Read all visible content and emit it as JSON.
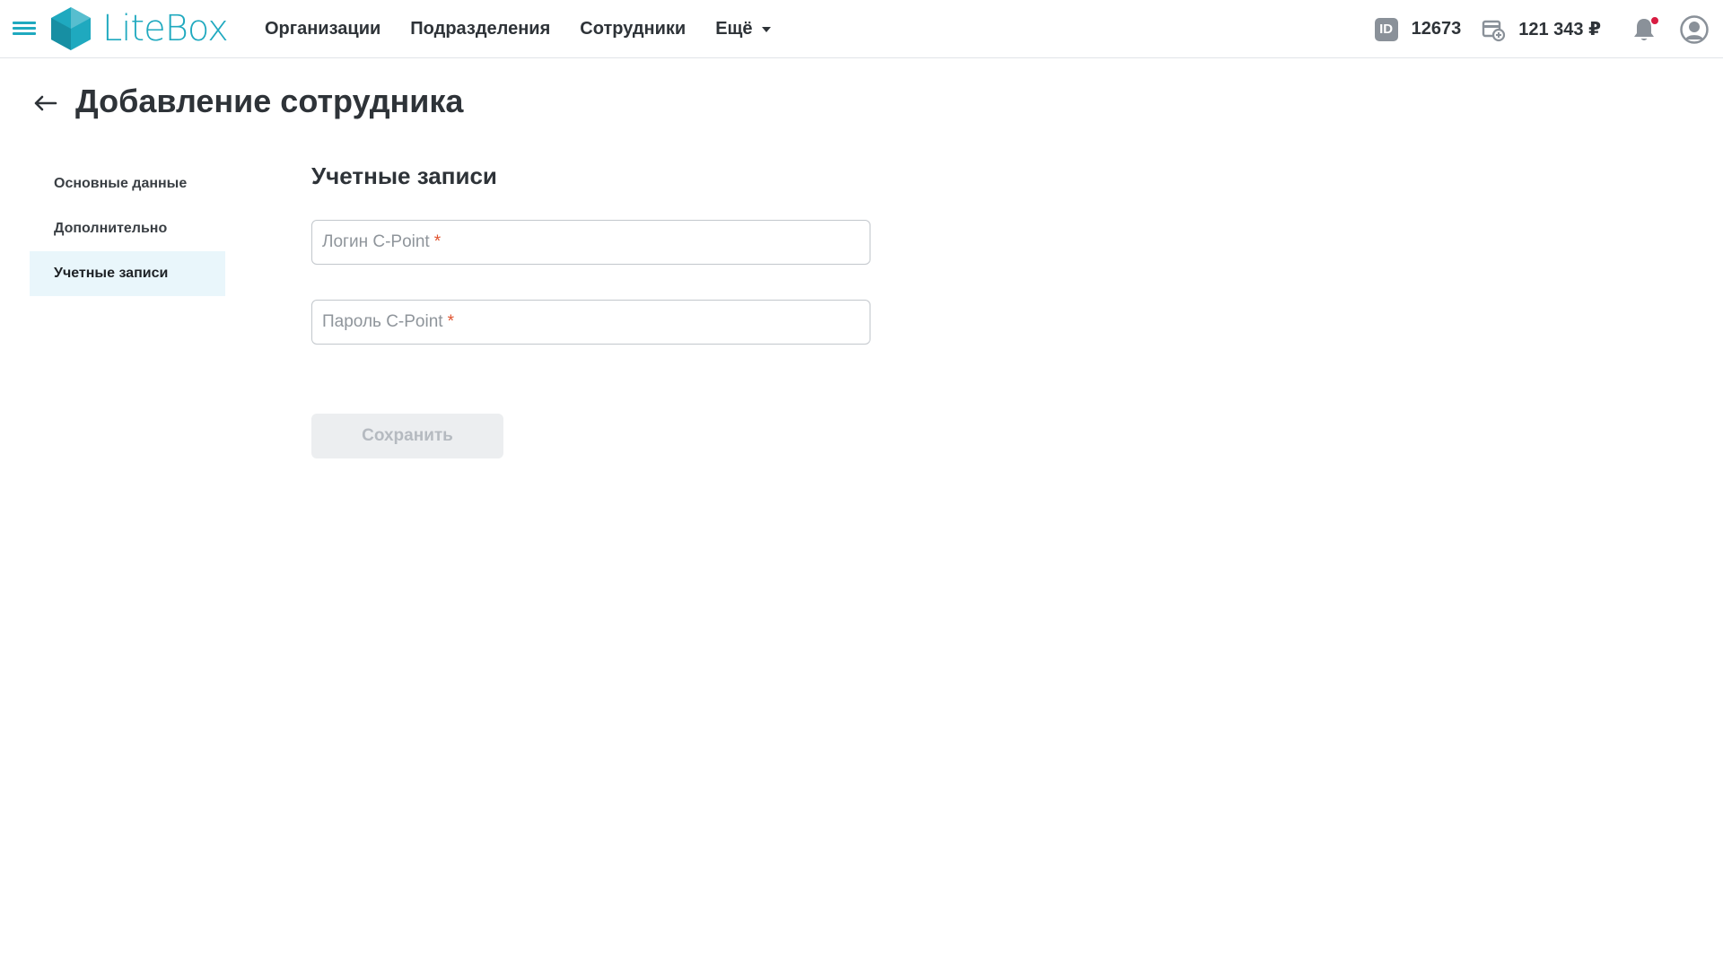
{
  "brand": {
    "name": "LiteBox",
    "color": "#1fa9bf"
  },
  "header": {
    "nav": [
      {
        "label": "Организации"
      },
      {
        "label": "Подразделения"
      },
      {
        "label": "Сотрудники"
      },
      {
        "label": "Ещё",
        "has_dropdown": true
      }
    ],
    "id_badge": "ID",
    "account_id": "12673",
    "balance": "121 343 ₽",
    "has_notifications": true,
    "notification_dot_color": "#d81b41"
  },
  "page": {
    "title": "Добавление сотрудника",
    "back_icon": "arrow-left-icon"
  },
  "sidemenu": {
    "items": [
      {
        "label": "Основные данные",
        "active": false
      },
      {
        "label": "Дополнительно",
        "active": false
      },
      {
        "label": "Учетные записи",
        "active": true
      }
    ]
  },
  "form": {
    "section_title": "Учетные записи",
    "login": {
      "placeholder": "Логин C-Point",
      "required_mark": "*",
      "value": ""
    },
    "password": {
      "placeholder": "Пароль C-Point",
      "required_mark": "*",
      "value": ""
    },
    "save_label": "Сохранить",
    "save_disabled": true
  }
}
